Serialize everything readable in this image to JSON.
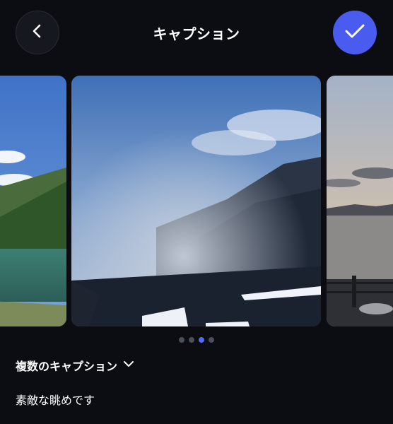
{
  "header": {
    "title": "キャプション",
    "back_icon": "chevron-left-icon",
    "confirm_icon": "checkmark-icon"
  },
  "carousel": {
    "slide_count": 4,
    "active_index": 2,
    "slides": [
      {
        "description_icon": "photo"
      },
      {
        "description_icon": "photo"
      },
      {
        "description_icon": "photo"
      }
    ]
  },
  "caption": {
    "mode_label": "複数のキャプション",
    "mode_icon": "chevron-down-icon",
    "value": "素敵な眺めです"
  },
  "colors": {
    "background": "#0b0d13",
    "accent": "#4a5cf0",
    "dot_inactive": "#4b4f58"
  }
}
